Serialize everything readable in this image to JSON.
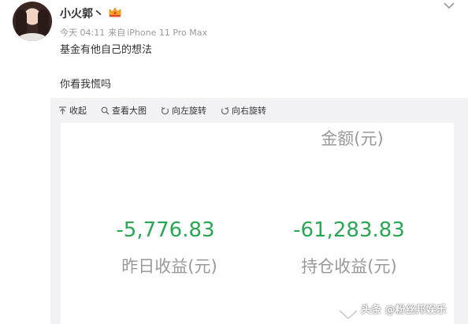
{
  "post": {
    "username": "小火郭丶",
    "time": "今天 04:11",
    "source_prefix": "来自",
    "device": "iPhone 11 Pro Max",
    "content_line1": "基金有他自己的想法",
    "content_line2": "你看我慌吗"
  },
  "toolbar": {
    "collapse": "收起",
    "view_large": "查看大图",
    "rotate_left": "向左旋转",
    "rotate_right": "向右旋转"
  },
  "image": {
    "header_label": "金额(元)",
    "yesterday_value": "-5,776.83",
    "yesterday_label": "昨日收益(元)",
    "holding_value": "-61,283.83",
    "holding_label": "持仓收益(元)"
  },
  "watermark": "头条 @粉丝邦娱乐",
  "colors": {
    "negative_value": "#2aa654",
    "muted_text": "#999999",
    "panel_bg": "#f2f2f5"
  },
  "icons": {
    "menu": "chevron-down-icon",
    "badge": "vip-crown-icon",
    "collapse": "arrow-up-icon",
    "view_large": "magnifier-icon",
    "rotate_left": "rotate-left-icon",
    "rotate_right": "rotate-right-icon"
  }
}
